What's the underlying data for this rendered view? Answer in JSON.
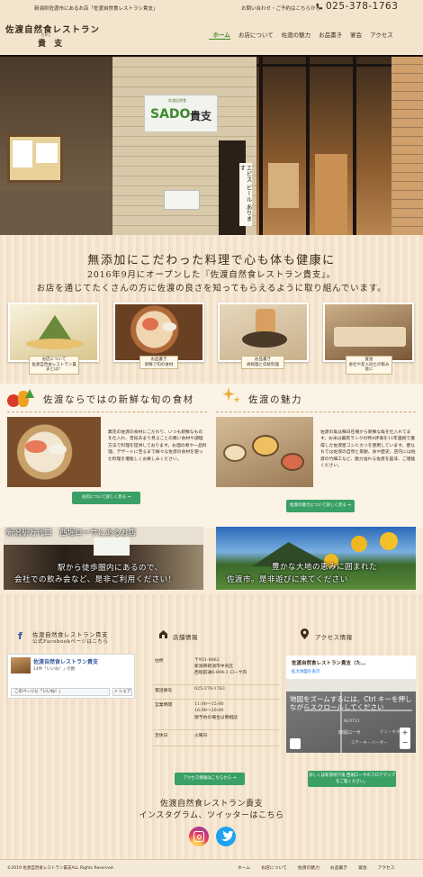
{
  "header": {
    "tagline": "新潟県佐渡市にあるお店「佐渡自然食レストラン貴支」",
    "contact_label": "お問い合わせ・ご予約はこちらから",
    "phone": "025-378-1763",
    "logo_line1": "佐渡自然食レストラン",
    "logo_line2": "貴 支",
    "logo_ruby": "たかし"
  },
  "nav": {
    "items": [
      "ホーム",
      "お店について",
      "佐渡の魅力",
      "お品書き",
      "宴会",
      "アクセス"
    ],
    "active": 0
  },
  "hero": {
    "sign_small": "佐渡自然食",
    "sign_brand": "SADO",
    "sign_name": "貴支",
    "banner_text": "エビス ビール あります"
  },
  "intro": {
    "heading": "無添加にこだわった料理で心も体も健康に",
    "line1": "2016年9月にオープンした『佐渡自然食レストラン貴支』。",
    "line2": "お店を通じてたくさんの方に佐渡の良さを知ってもらえるように取り組んでいます。"
  },
  "thumbs": [
    {
      "badge": "お店について\n佐渡自然食レストラン貴支とは？"
    },
    {
      "badge": "お品書き\n新鮮で旬の食材"
    },
    {
      "badge": "お品書き\n尚純理と伝統料理"
    },
    {
      "badge": "宴会\n会社や友人同士の飲み会に"
    }
  ],
  "section1": {
    "title": "佐渡ならではの新鮮な旬の食材",
    "text": "無花の佐渡の食材にこだわり、いつも新鮮なものを仕入れ、普段あまり見ることの無い食材や調理方法で料理を提供しております。お酒の肴や一品料理、デザートに至るまで様々な佐渡の食材を使った料理を堪能しくお楽しみください。",
    "button": "お店について詳しく見る ⇒"
  },
  "section2": {
    "title": "佐渡の魅力",
    "text": "佐渡の魚は鮮日在場から新鮮な魚を仕入れてます。お米は最高ランクの特A評価を11年連続で獲得した佐渡産コシヒカリを使用しています。豊なちでは佐渡の自然と景観、食や歴史、店内には佐渡の竹細工など、魅力溢れる佐渡を是非、ご堪能ください。",
    "button": "佐渡の魅力について詳しく見る ⇒"
  },
  "banners": [
    {
      "title": "新潟駅万代口　西堀ローサにあるお店",
      "line1": "駅から徒歩圏内にあるので、",
      "line2": "会社での飲み会など、是非ご利用ください！"
    },
    {
      "title": "",
      "line1": "豊かな大地の恵みに囲まれた",
      "line2": "佐渡市。是非遊びに来てください"
    }
  ],
  "facebook": {
    "title_line1": "佐渡自然食レストラン貴支",
    "title_line2": "公式Facebookページはこちら",
    "page_name": "佐渡自然食レストラン貴支",
    "likes": "14件「いいね！」の数",
    "like_button": "このページに「いいね！」",
    "share": "↗ シェア"
  },
  "store_info": {
    "title": "店舗情報",
    "rows": [
      {
        "label": "住所",
        "value": "〒951-8062\n新潟県新潟市中央区\n西堀前通6-894-1 ローサ内"
      },
      {
        "label": "電話番号",
        "value": "025-378-1763"
      },
      {
        "label": "営業時間",
        "value": "11:00〜15:00\n16:00〜20:00\n御予約の場合は要相談"
      },
      {
        "label": "定休日",
        "value": "火曜日"
      }
    ],
    "button": "アクセス情報はこちらから ⇒"
  },
  "access": {
    "title": "アクセス情報",
    "map_title": "佐渡自然食レストラン貴支（た…",
    "map_link": "拡大地図を表示",
    "map_overlay": "地図をズームするには、Ctrl キーを押しながらスクロールしてください",
    "map_labels": [
      "西堀ローサ",
      "NEXT21",
      "ドン・キホーテ",
      "ステーキ・バーガー"
    ],
    "note": "詳しくは新潟地下街 西堀ローサのフロアマップをご覧ください。"
  },
  "social": {
    "line1": "佐渡自然食レストラン貴支",
    "line2": "インスタグラム、ツイッターはこちら"
  },
  "footer": {
    "copyright": "©2019 佐渡自然食レストラン貴支ALL Rights Reserved.",
    "links": [
      "ホーム",
      "お店について",
      "佐渡の魅力",
      "お品書き",
      "宴会",
      "アクセス"
    ]
  },
  "colors": {
    "accent_green": "#3aa066",
    "nav_active": "#3a8a28",
    "background": "#f6ead8"
  }
}
